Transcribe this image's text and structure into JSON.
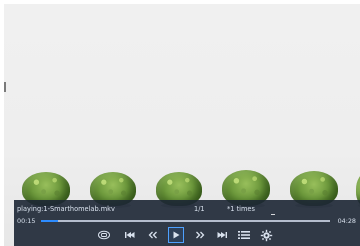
{
  "player": {
    "now_playing": "playing:1-Smarthomelab.mkv",
    "track_index": "1/1",
    "repeat_count": "*1 times",
    "elapsed": "00:15",
    "duration": "04:28",
    "progress_percent": 6
  },
  "controls": [
    {
      "name": "subtitle-icon"
    },
    {
      "name": "previous-track-icon"
    },
    {
      "name": "rewind-icon"
    },
    {
      "name": "play-icon"
    },
    {
      "name": "fast-forward-icon"
    },
    {
      "name": "next-track-icon"
    },
    {
      "name": "playlist-icon"
    },
    {
      "name": "settings-gear-icon"
    }
  ],
  "colors": {
    "bar_background": "#1c2634",
    "accent": "#2d8cff",
    "text": "#d9e2ee"
  }
}
